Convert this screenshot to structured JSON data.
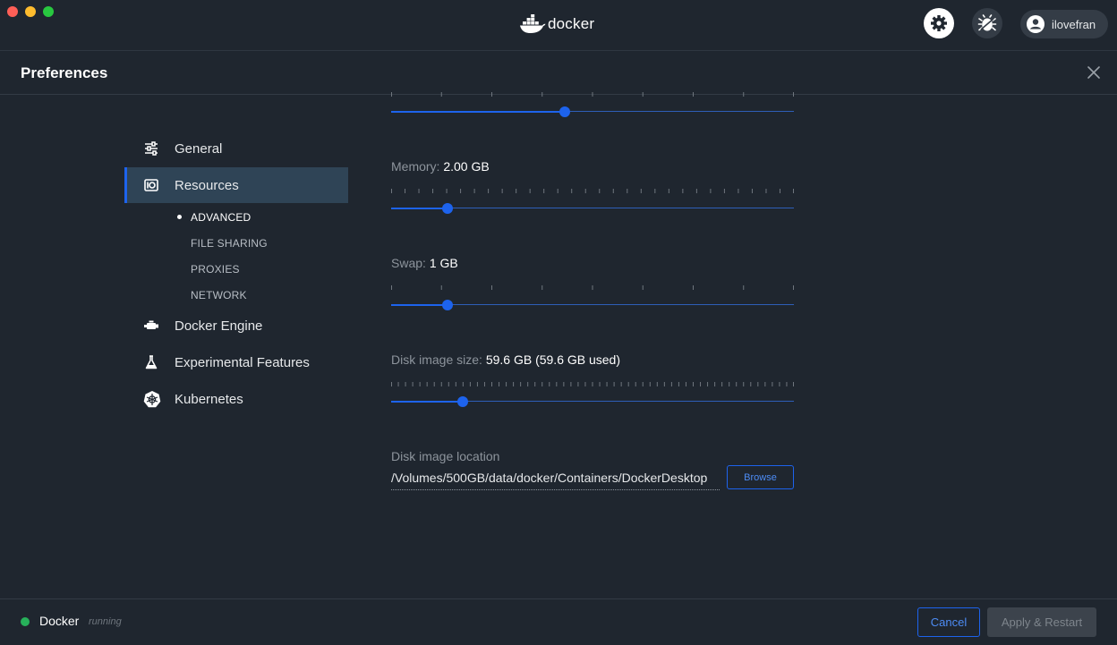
{
  "app": {
    "logo_text": "docker",
    "user_name": "ilovefran"
  },
  "header": {
    "title": "Preferences"
  },
  "sidebar": {
    "items": [
      {
        "label": "General",
        "icon": "sliders-icon"
      },
      {
        "label": "Resources",
        "icon": "resources-icon",
        "active": true
      },
      {
        "label": "Docker Engine",
        "icon": "engine-icon"
      },
      {
        "label": "Experimental Features",
        "icon": "flask-icon"
      },
      {
        "label": "Kubernetes",
        "icon": "helm-icon"
      }
    ],
    "subitems": [
      {
        "label": "ADVANCED",
        "active": true
      },
      {
        "label": "FILE SHARING"
      },
      {
        "label": "PROXIES"
      },
      {
        "label": "NETWORK"
      }
    ]
  },
  "resources": {
    "cpu": {
      "fraction": 0.43
    },
    "memory": {
      "label": "Memory:",
      "value": "2.00 GB",
      "fraction": 0.14
    },
    "swap": {
      "label": "Swap:",
      "value": "1 GB",
      "fraction": 0.14
    },
    "disk": {
      "label": "Disk image size:",
      "value": "59.6 GB (59.6 GB used)",
      "fraction": 0.178
    },
    "location": {
      "label": "Disk image location",
      "value": "/Volumes/500GB/data/docker/Containers/DockerDesktop",
      "browse_label": "Browse"
    }
  },
  "footer": {
    "status_name": "Docker",
    "status_state": "running",
    "cancel_label": "Cancel",
    "apply_label": "Apply & Restart"
  },
  "colors": {
    "accent": "#1d63ed",
    "status_running": "#27b05a",
    "background": "#1f262f"
  }
}
